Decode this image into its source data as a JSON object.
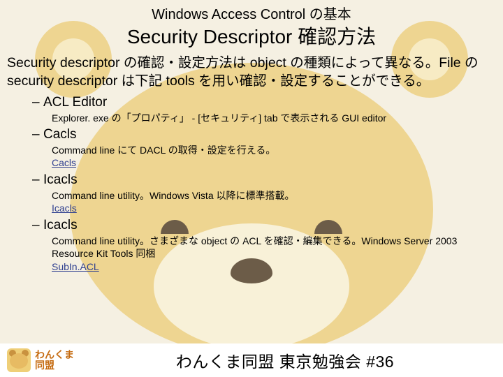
{
  "header": {
    "supertitle": "Windows Access Control の基本",
    "title": "Security Descriptor 確認方法"
  },
  "intro": "Security descriptor の確認・設定方法は object の種類によって異なる。File の security descriptor は下記 tools を用い確認・設定することができる。",
  "items": [
    {
      "name": "ACL Editor",
      "desc": "Explorer. exe の「プロパティ」 - [セキュリティ] tab で表示される GUI editor",
      "link": null
    },
    {
      "name": "Cacls",
      "desc": "Command line にて DACL の取得・設定を行える。",
      "link": "Cacls"
    },
    {
      "name": "Icacls",
      "desc": "Command line utility。Windows Vista 以降に標準搭載。",
      "link": "Icacls"
    },
    {
      "name": "Icacls",
      "desc": "Command line utility。さまざまな object の ACL を確認・編集できる。Windows Server 2003 Resource Kit Tools 同梱",
      "link": "SubIn.ACL"
    }
  ],
  "footer": {
    "logo_line1": "わんくま",
    "logo_line2": "同盟",
    "session": "わんくま同盟 東京勉強会 #36"
  }
}
